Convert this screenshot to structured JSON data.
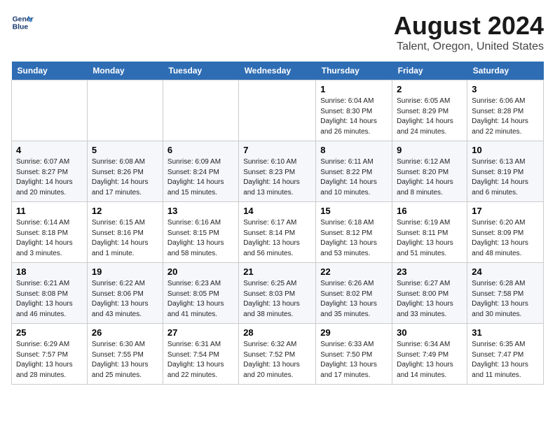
{
  "logo": {
    "line1": "General",
    "line2": "Blue"
  },
  "title": "August 2024",
  "subtitle": "Talent, Oregon, United States",
  "header": {
    "accent_color": "#2e6db4"
  },
  "weekdays": [
    "Sunday",
    "Monday",
    "Tuesday",
    "Wednesday",
    "Thursday",
    "Friday",
    "Saturday"
  ],
  "weeks": [
    [
      {
        "day": "",
        "info": ""
      },
      {
        "day": "",
        "info": ""
      },
      {
        "day": "",
        "info": ""
      },
      {
        "day": "",
        "info": ""
      },
      {
        "day": "1",
        "info": "Sunrise: 6:04 AM\nSunset: 8:30 PM\nDaylight: 14 hours\nand 26 minutes."
      },
      {
        "day": "2",
        "info": "Sunrise: 6:05 AM\nSunset: 8:29 PM\nDaylight: 14 hours\nand 24 minutes."
      },
      {
        "day": "3",
        "info": "Sunrise: 6:06 AM\nSunset: 8:28 PM\nDaylight: 14 hours\nand 22 minutes."
      }
    ],
    [
      {
        "day": "4",
        "info": "Sunrise: 6:07 AM\nSunset: 8:27 PM\nDaylight: 14 hours\nand 20 minutes."
      },
      {
        "day": "5",
        "info": "Sunrise: 6:08 AM\nSunset: 8:26 PM\nDaylight: 14 hours\nand 17 minutes."
      },
      {
        "day": "6",
        "info": "Sunrise: 6:09 AM\nSunset: 8:24 PM\nDaylight: 14 hours\nand 15 minutes."
      },
      {
        "day": "7",
        "info": "Sunrise: 6:10 AM\nSunset: 8:23 PM\nDaylight: 14 hours\nand 13 minutes."
      },
      {
        "day": "8",
        "info": "Sunrise: 6:11 AM\nSunset: 8:22 PM\nDaylight: 14 hours\nand 10 minutes."
      },
      {
        "day": "9",
        "info": "Sunrise: 6:12 AM\nSunset: 8:20 PM\nDaylight: 14 hours\nand 8 minutes."
      },
      {
        "day": "10",
        "info": "Sunrise: 6:13 AM\nSunset: 8:19 PM\nDaylight: 14 hours\nand 6 minutes."
      }
    ],
    [
      {
        "day": "11",
        "info": "Sunrise: 6:14 AM\nSunset: 8:18 PM\nDaylight: 14 hours\nand 3 minutes."
      },
      {
        "day": "12",
        "info": "Sunrise: 6:15 AM\nSunset: 8:16 PM\nDaylight: 14 hours\nand 1 minute."
      },
      {
        "day": "13",
        "info": "Sunrise: 6:16 AM\nSunset: 8:15 PM\nDaylight: 13 hours\nand 58 minutes."
      },
      {
        "day": "14",
        "info": "Sunrise: 6:17 AM\nSunset: 8:14 PM\nDaylight: 13 hours\nand 56 minutes."
      },
      {
        "day": "15",
        "info": "Sunrise: 6:18 AM\nSunset: 8:12 PM\nDaylight: 13 hours\nand 53 minutes."
      },
      {
        "day": "16",
        "info": "Sunrise: 6:19 AM\nSunset: 8:11 PM\nDaylight: 13 hours\nand 51 minutes."
      },
      {
        "day": "17",
        "info": "Sunrise: 6:20 AM\nSunset: 8:09 PM\nDaylight: 13 hours\nand 48 minutes."
      }
    ],
    [
      {
        "day": "18",
        "info": "Sunrise: 6:21 AM\nSunset: 8:08 PM\nDaylight: 13 hours\nand 46 minutes."
      },
      {
        "day": "19",
        "info": "Sunrise: 6:22 AM\nSunset: 8:06 PM\nDaylight: 13 hours\nand 43 minutes."
      },
      {
        "day": "20",
        "info": "Sunrise: 6:23 AM\nSunset: 8:05 PM\nDaylight: 13 hours\nand 41 minutes."
      },
      {
        "day": "21",
        "info": "Sunrise: 6:25 AM\nSunset: 8:03 PM\nDaylight: 13 hours\nand 38 minutes."
      },
      {
        "day": "22",
        "info": "Sunrise: 6:26 AM\nSunset: 8:02 PM\nDaylight: 13 hours\nand 35 minutes."
      },
      {
        "day": "23",
        "info": "Sunrise: 6:27 AM\nSunset: 8:00 PM\nDaylight: 13 hours\nand 33 minutes."
      },
      {
        "day": "24",
        "info": "Sunrise: 6:28 AM\nSunset: 7:58 PM\nDaylight: 13 hours\nand 30 minutes."
      }
    ],
    [
      {
        "day": "25",
        "info": "Sunrise: 6:29 AM\nSunset: 7:57 PM\nDaylight: 13 hours\nand 28 minutes."
      },
      {
        "day": "26",
        "info": "Sunrise: 6:30 AM\nSunset: 7:55 PM\nDaylight: 13 hours\nand 25 minutes."
      },
      {
        "day": "27",
        "info": "Sunrise: 6:31 AM\nSunset: 7:54 PM\nDaylight: 13 hours\nand 22 minutes."
      },
      {
        "day": "28",
        "info": "Sunrise: 6:32 AM\nSunset: 7:52 PM\nDaylight: 13 hours\nand 20 minutes."
      },
      {
        "day": "29",
        "info": "Sunrise: 6:33 AM\nSunset: 7:50 PM\nDaylight: 13 hours\nand 17 minutes."
      },
      {
        "day": "30",
        "info": "Sunrise: 6:34 AM\nSunset: 7:49 PM\nDaylight: 13 hours\nand 14 minutes."
      },
      {
        "day": "31",
        "info": "Sunrise: 6:35 AM\nSunset: 7:47 PM\nDaylight: 13 hours\nand 11 minutes."
      }
    ]
  ]
}
